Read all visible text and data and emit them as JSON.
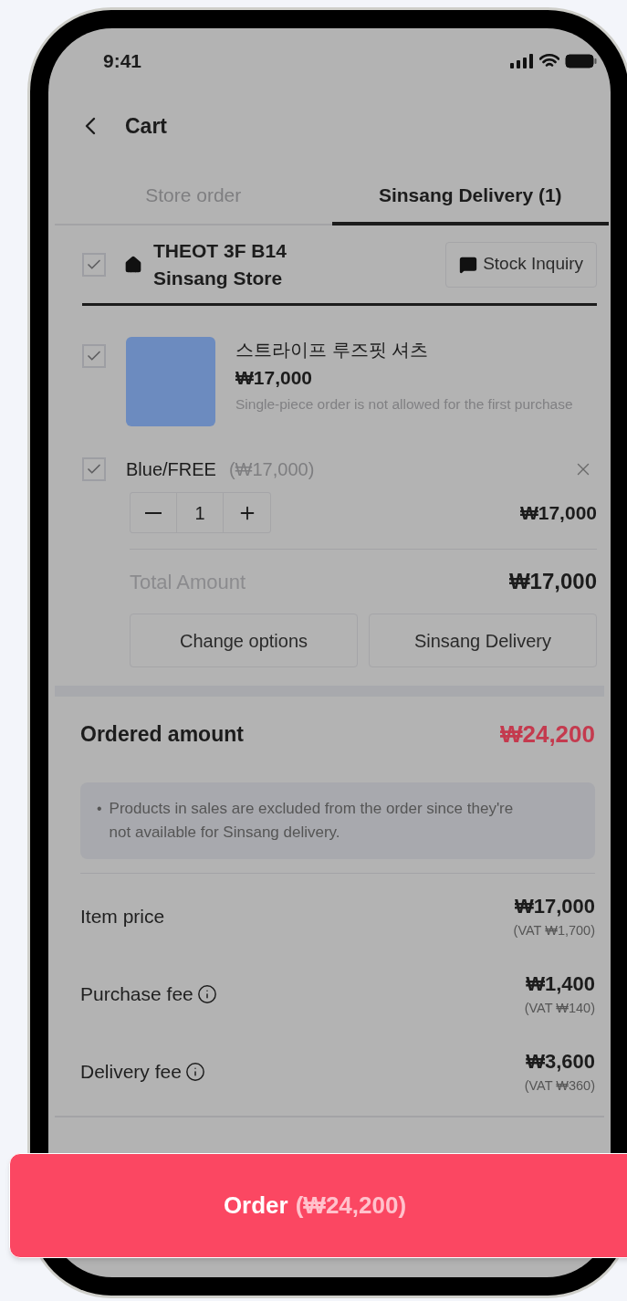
{
  "status_bar": {
    "time": "9:41"
  },
  "header": {
    "title": "Cart"
  },
  "tabs": [
    {
      "label": "Store order",
      "selected": false
    },
    {
      "label": "Sinsang Delivery (1)",
      "selected": true
    }
  ],
  "store": {
    "checked": true,
    "name": "THEOT 3F B14 Sinsang Store",
    "inquiry_button": "Stock Inquiry"
  },
  "product": {
    "checked": true,
    "name": "스트라이프 루즈핏 셔츠",
    "price": "₩17,000",
    "note": "Single-piece order is not allowed for the first purchase"
  },
  "option": {
    "checked": true,
    "label": "Blue/FREE",
    "unit_price": "(₩17,000)",
    "quantity": "1",
    "line_total": "₩17,000"
  },
  "total": {
    "label": "Total Amount",
    "value": "₩17,000"
  },
  "actions": [
    "Change options",
    "Sinsang Delivery"
  ],
  "summary": {
    "title": "Ordered amount",
    "value": "₩24,200",
    "notice_bullet": "•",
    "notice": "Products in sales are excluded from the order since they're not available for Sinsang delivery."
  },
  "fees": [
    {
      "label": "Item price",
      "info": false,
      "amount": "₩17,000",
      "vat": "(VAT ₩1,700)"
    },
    {
      "label": "Purchase fee",
      "info": true,
      "amount": "₩1,400",
      "vat": "(VAT ₩140)"
    },
    {
      "label": "Delivery fee",
      "info": true,
      "amount": "₩3,600",
      "vat": "(VAT ₩360)"
    }
  ],
  "order_button": {
    "label": "Order",
    "amount": "(₩24,200)"
  }
}
